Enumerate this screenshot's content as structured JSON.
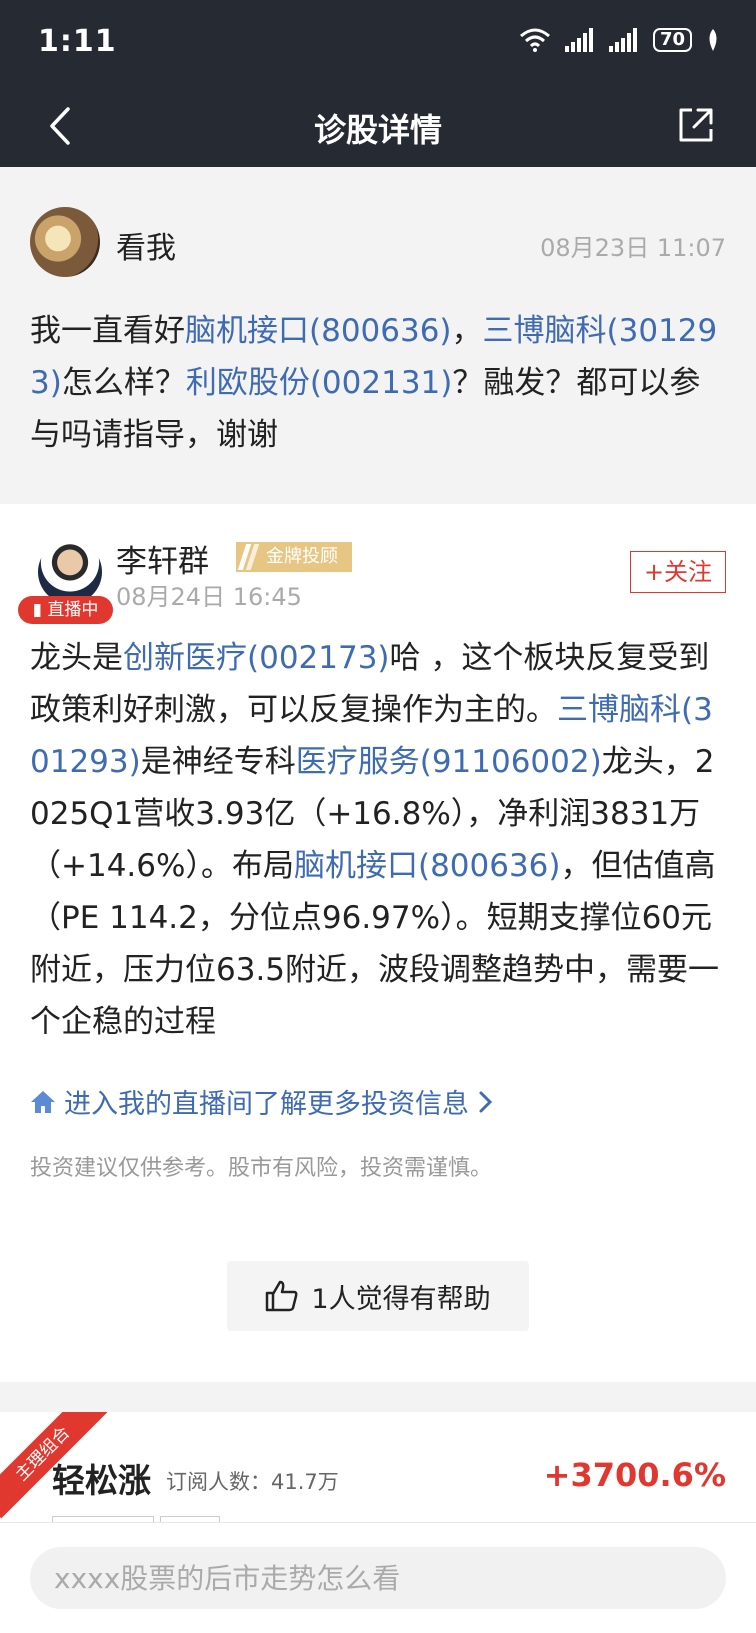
{
  "status": {
    "time": "1:11",
    "battery": "70"
  },
  "nav": {
    "title": "诊股详情"
  },
  "question": {
    "user": "看我",
    "time": "08月23日 11:07",
    "segments": [
      {
        "t": "我一直看好",
        "link": false
      },
      {
        "t": "脑机接口(800636)",
        "link": true
      },
      {
        "t": "，",
        "link": false
      },
      {
        "t": "三博脑科(301293)",
        "link": true
      },
      {
        "t": "怎么样？",
        "link": false
      },
      {
        "t": "利欧股份(002131)",
        "link": true
      },
      {
        "t": "？融发？都可以参与吗请指导，谢谢",
        "link": false
      }
    ]
  },
  "answer": {
    "name": "李轩群",
    "badge": "金牌投顾",
    "live": "直播中",
    "time": "08月24日 16:45",
    "follow": "+关注",
    "segments": [
      {
        "t": "龙头是",
        "link": false
      },
      {
        "t": "创新医疗(002173)",
        "link": true
      },
      {
        "t": "哈 ，这个板块反复受到政策利好刺激，可以反复操作为主的。",
        "link": false
      },
      {
        "t": "三博脑科(301293)",
        "link": true
      },
      {
        "t": "是神经专科",
        "link": false
      },
      {
        "t": "医疗服务(91106002)",
        "link": true
      },
      {
        "t": "龙头，2025Q1营收3.93亿（+16.8%），净利润3831万（+14.6%）。布局",
        "link": false
      },
      {
        "t": "脑机接口(800636)",
        "link": true
      },
      {
        "t": "，但估值高（PE 114.2，分位点96.97%）。短期支撑位60元附近，压力位63.5附近，波段调整趋势中，需要一个企稳的过程",
        "link": false
      }
    ],
    "live_link": "进入我的直播间了解更多投资信息",
    "disclaimer": "投资建议仅供参考。股市有风险，投资需谨慎。",
    "helpful": "1人觉得有帮助"
  },
  "portfolio": {
    "ribbon": "主理组合",
    "title": "轻松涨",
    "subscribers": "订阅人数：41.7万",
    "gain": "+3700.6%"
  },
  "search": {
    "placeholder": "xxxx股票的后市走势怎么看"
  }
}
